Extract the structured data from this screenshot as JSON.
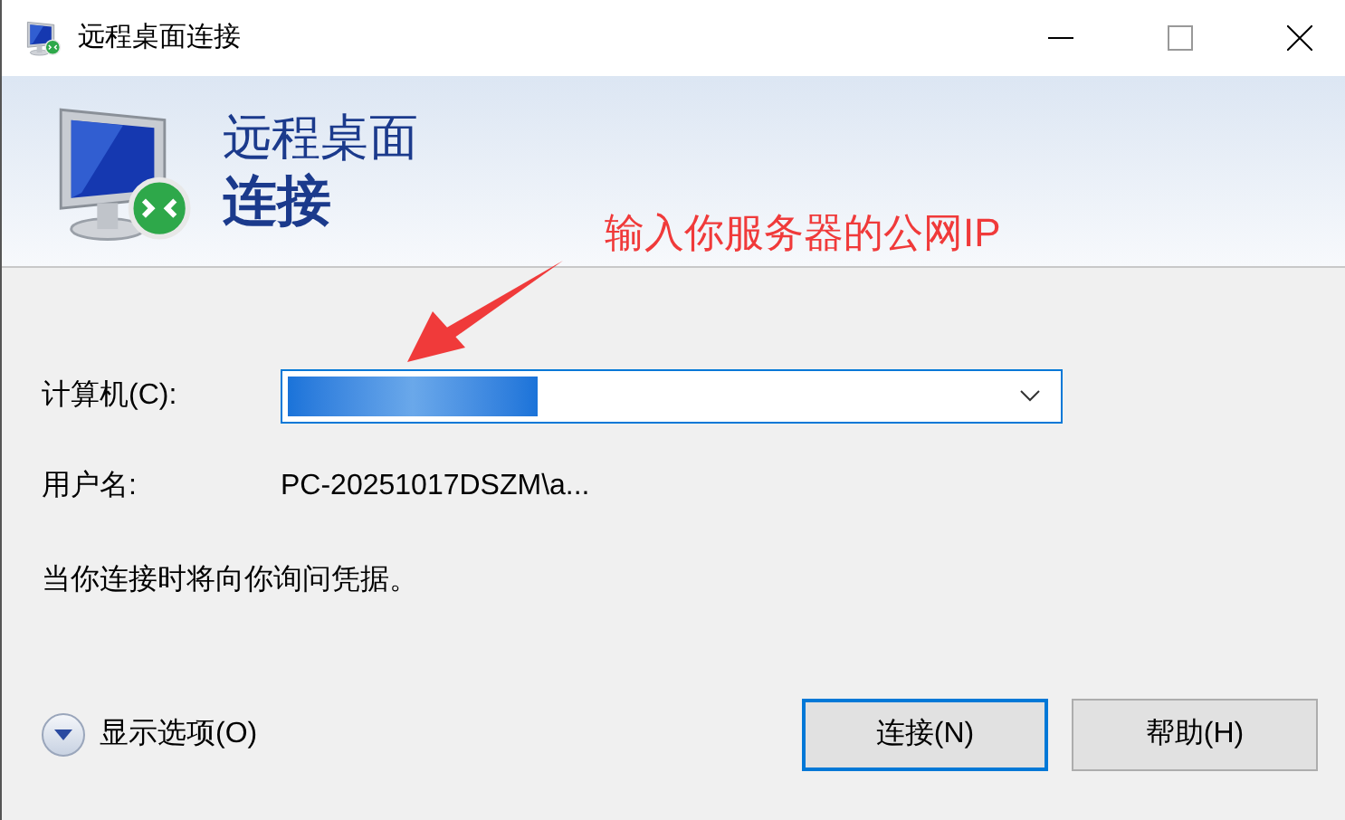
{
  "window": {
    "title": "远程桌面连接"
  },
  "banner": {
    "line1": "远程桌面",
    "line2": "连接"
  },
  "annotation": {
    "text": "输入你服务器的公网IP"
  },
  "fields": [
    {
      "kind": "combo",
      "label": "计算机(C):",
      "redacted": true
    },
    {
      "kind": "text",
      "label": "用户名:",
      "value": "PC-20251017DSZM\\a..."
    }
  ],
  "note": "当你连接时将向你询问凭据。",
  "options_toggle": {
    "label": "显示选项(O)",
    "expanded": false
  },
  "buttons": [
    {
      "label": "连接(N)",
      "default": true
    },
    {
      "label": "帮助(H)",
      "default": false
    }
  ]
}
